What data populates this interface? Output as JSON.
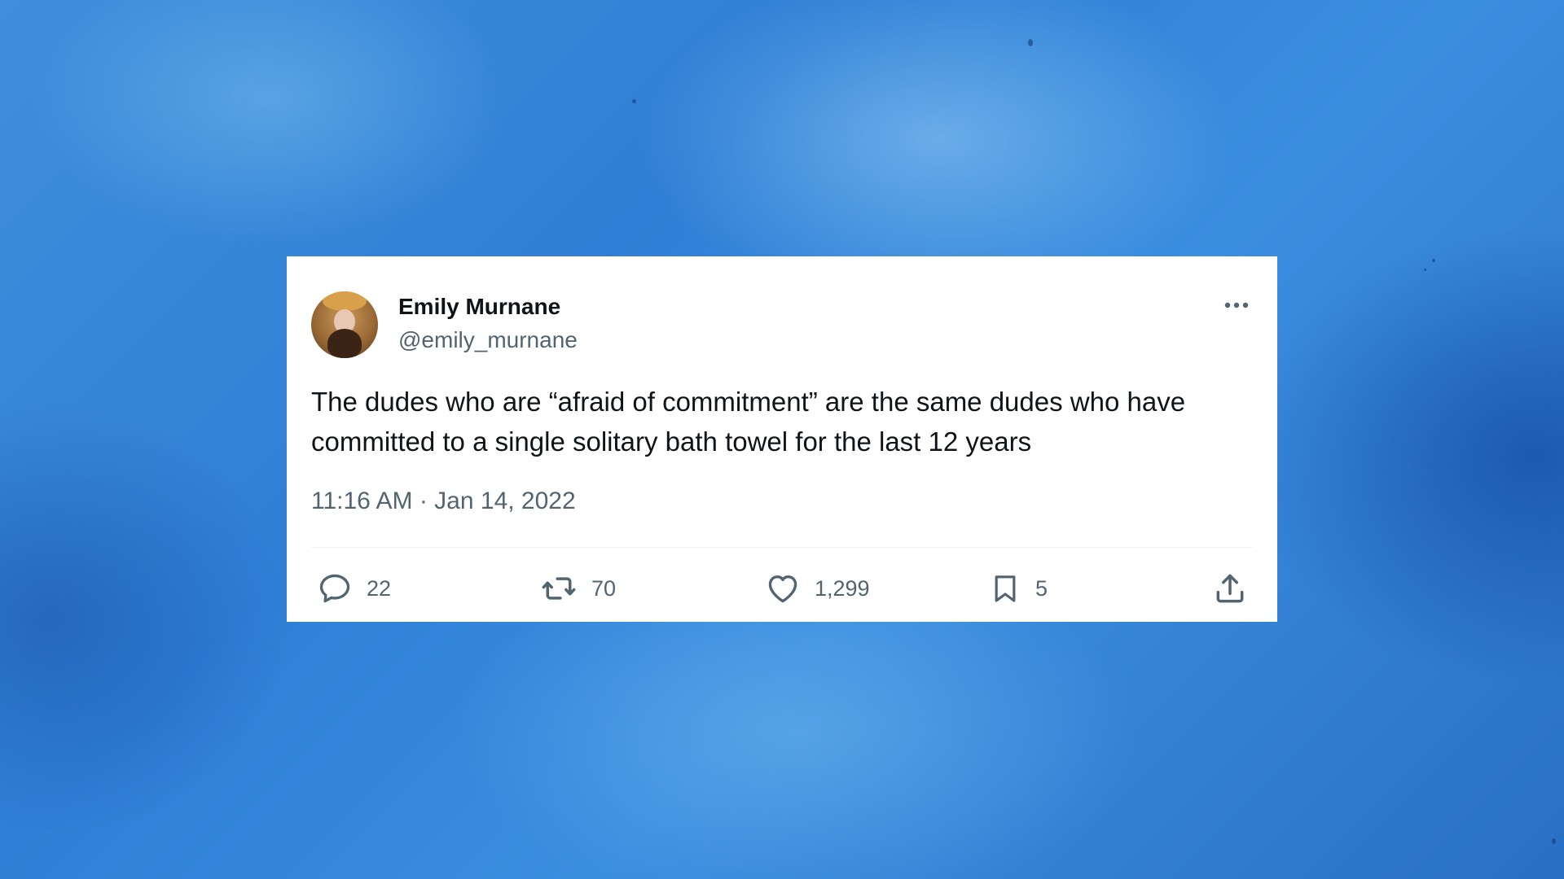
{
  "tweet": {
    "author": {
      "display_name": "Emily Murnane",
      "handle": "@emily_murnane",
      "avatar": "avatar-photo"
    },
    "text": "The dudes who are “afraid of commitment” are the same dudes who have committed to a single solitary bath towel for the last 12 years",
    "timestamp": "11:16 AM · Jan 14, 2022",
    "more_icon": "ellipsis-icon",
    "actions": {
      "reply": {
        "icon": "reply-icon",
        "count": "22"
      },
      "retweet": {
        "icon": "retweet-icon",
        "count": "70"
      },
      "like": {
        "icon": "heart-icon",
        "count": "1,299"
      },
      "bookmark": {
        "icon": "bookmark-icon",
        "count": "5"
      },
      "share": {
        "icon": "share-icon"
      }
    }
  },
  "colors": {
    "background": "#3a8ee0",
    "card": "#ffffff",
    "primary_text": "#0f1419",
    "secondary_text": "#536471"
  }
}
